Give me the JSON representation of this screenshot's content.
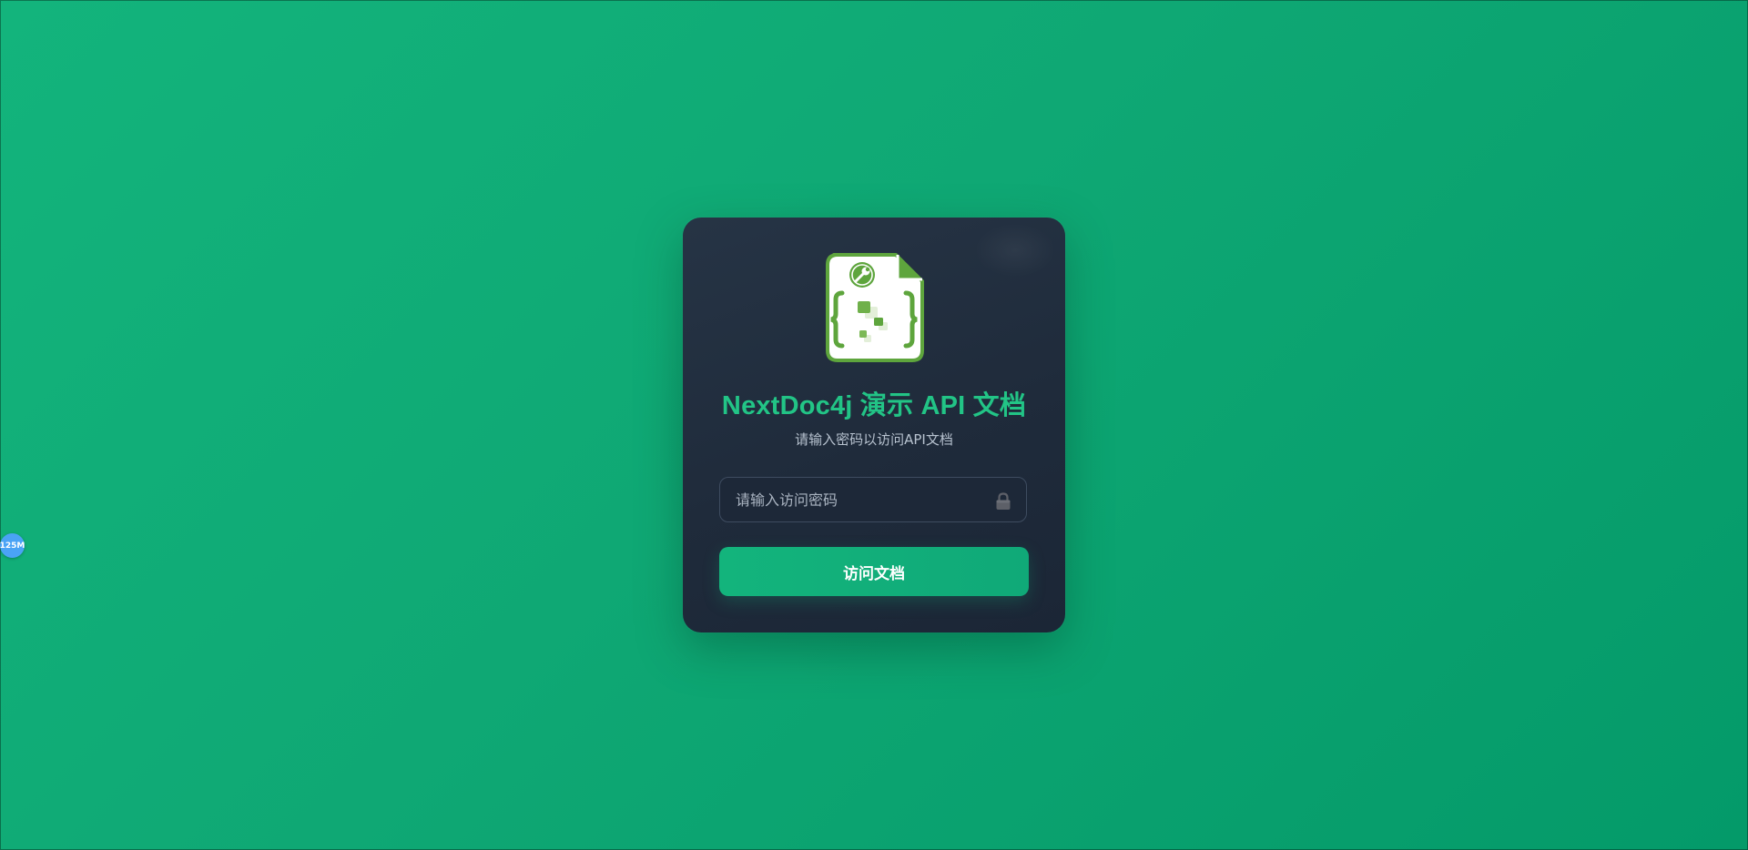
{
  "page": {
    "title": "NextDoc4j 演示 API 文档",
    "subtitle": "请输入密码以访问API文档"
  },
  "login": {
    "password_value": "",
    "password_placeholder": "请输入访问密码",
    "submit_label": "访问文档",
    "lock_icon": "lock-icon"
  },
  "overlay": {
    "memory_badge": "125M"
  },
  "colors": {
    "background": "#10ac76",
    "card": "#222e3f",
    "accent": "#22c486",
    "button": "#13b47c",
    "logo_green": "#5ea53d"
  }
}
